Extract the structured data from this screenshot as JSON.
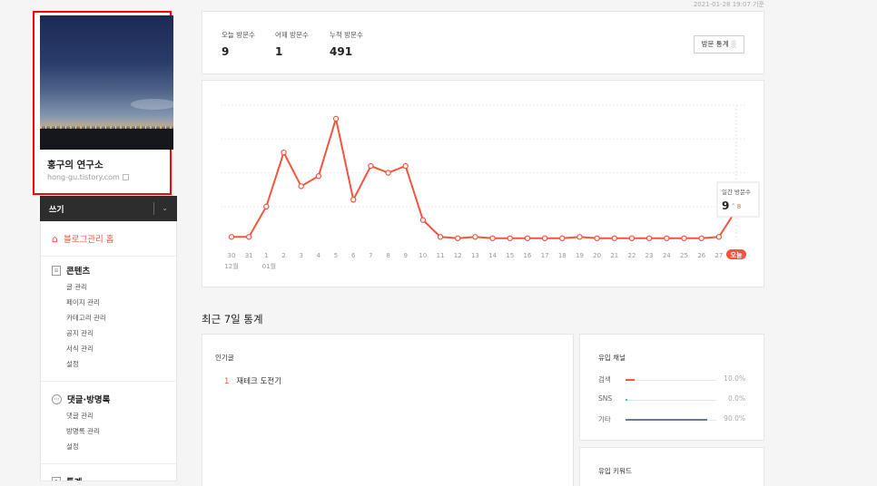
{
  "timestamp": "2021-01-28 19:07 기준",
  "profile": {
    "name": "홍구의 연구소",
    "url": "hong-gu.tistory.com"
  },
  "write": {
    "label": "쓰기"
  },
  "menu": {
    "home": "블로그관리 홈",
    "sections": [
      {
        "title": "콘텐츠",
        "items": [
          "글 관리",
          "페이지 관리",
          "카테고리 관리",
          "공지 관리",
          "서식 관리",
          "설정"
        ]
      },
      {
        "title": "댓글·방명록",
        "items": [
          "댓글 관리",
          "방명록 관리",
          "설정"
        ]
      },
      {
        "title": "통계",
        "items": []
      }
    ]
  },
  "summary": {
    "today_label": "오늘 방문수",
    "today": "9",
    "yesterday_label": "어제 방문수",
    "yesterday": "1",
    "total_label": "누적 방문수",
    "total": "491",
    "button": "방문 통계"
  },
  "chart_data": {
    "type": "line",
    "x": [
      "30",
      "31",
      "1",
      "2",
      "3",
      "4",
      "5",
      "6",
      "7",
      "8",
      "9",
      "10",
      "11",
      "12",
      "13",
      "14",
      "15",
      "16",
      "17",
      "18",
      "19",
      "20",
      "21",
      "22",
      "23",
      "24",
      "25",
      "26",
      "27",
      "오늘"
    ],
    "month_labels": [
      "12월",
      "01월"
    ],
    "series": [
      {
        "values": [
          1,
          1,
          10,
          26,
          16,
          19,
          36,
          12,
          22,
          20,
          22,
          6,
          1,
          0.6,
          1,
          0.6,
          0.6,
          0.6,
          0.6,
          0.6,
          1,
          0.6,
          0.6,
          0.6,
          0.6,
          0.6,
          0.6,
          0.6,
          1,
          9
        ],
        "color": "#f0553d"
      }
    ],
    "ylim": [
      0,
      40
    ],
    "grid": true,
    "tooltip": {
      "label": "일간 방문수",
      "value": "9",
      "delta": "8"
    },
    "today_badge": "오늘"
  },
  "recent": {
    "title": "최근 7일 통계",
    "popular": {
      "title": "인기글",
      "rows": [
        {
          "rank": "1",
          "title": "재테크 도전기"
        }
      ]
    },
    "channels": {
      "title": "유입 채널",
      "rows": [
        {
          "name": "검색",
          "pct": "10.0%",
          "value": 10,
          "color": "#f0553d"
        },
        {
          "name": "SNS",
          "pct": "0.0%",
          "value": 0,
          "color": "#3bb5d6"
        },
        {
          "name": "기타",
          "pct": "90.0%",
          "value": 90,
          "color": "#6b7a8f"
        }
      ]
    },
    "keywords": {
      "title": "유입 키워드"
    }
  }
}
